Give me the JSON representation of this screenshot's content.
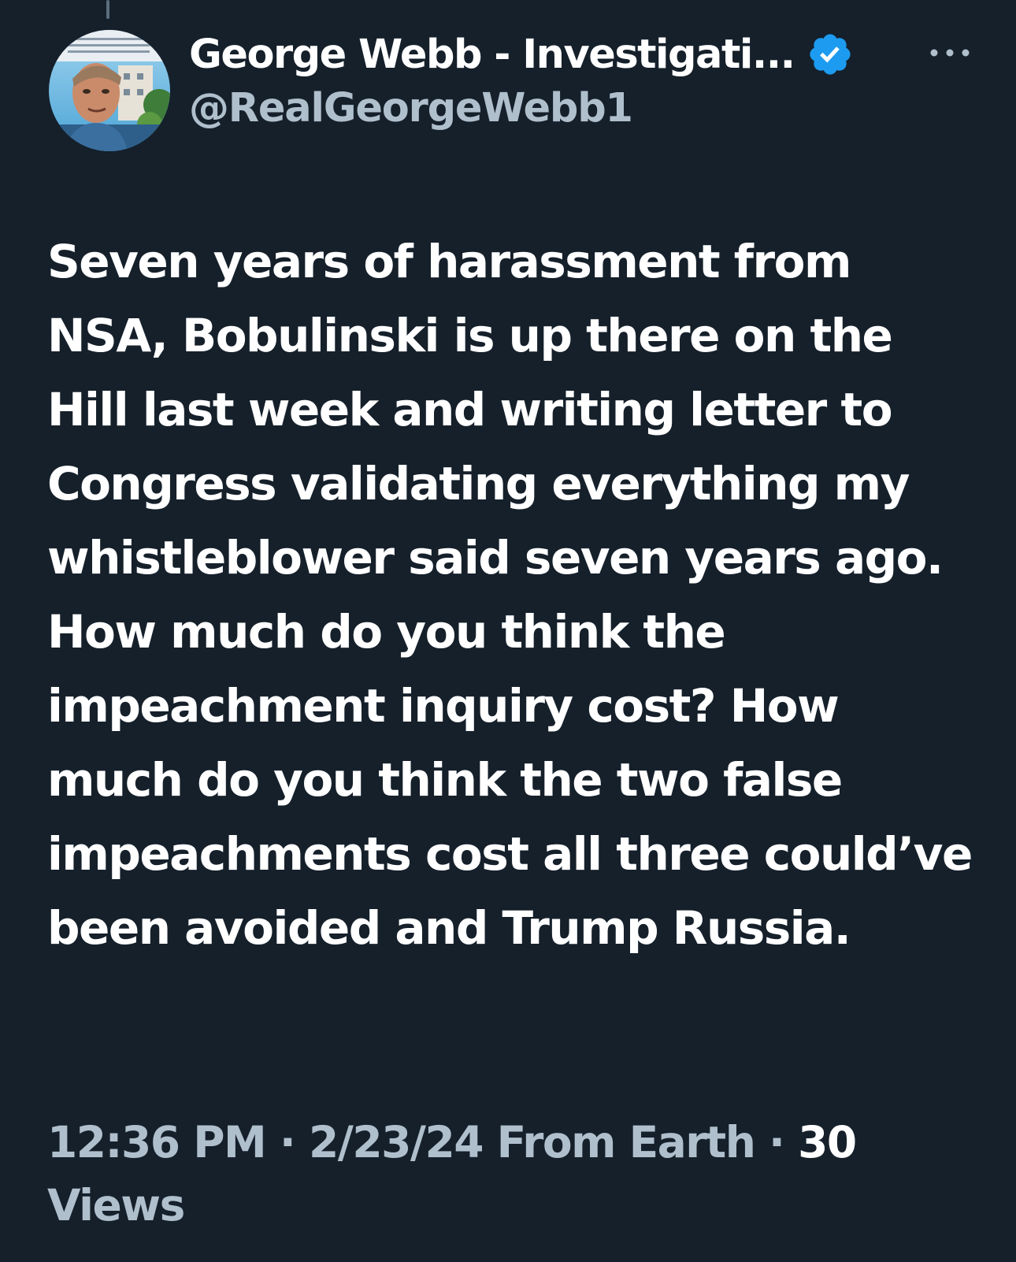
{
  "tweet": {
    "author": {
      "display_name": "George Webb - Investigati...",
      "handle": "@RealGeorgeWebb1",
      "verified": true,
      "avatar_icon": "profile-photo"
    },
    "more_icon": "more-dots-icon",
    "text": "Seven years of harassment from NSA, Bobulinski is up there on the Hill last week and writing letter to Congress validating everything my whistleblower said seven years ago. How much do you think the impeachment inquiry cost? How much do you think the two false impeachments cost all three could’ve been avoided and Trump Russia.",
    "time": "12:36 PM",
    "separator": "·",
    "date": "2/23/24",
    "source": "From Earth",
    "views_count": "30",
    "views_label": "Views"
  },
  "colors": {
    "background": "#15202b",
    "text_primary": "#ffffff",
    "text_secondary": "#b0bfcc",
    "verified_badge": "#1d9bf0"
  }
}
